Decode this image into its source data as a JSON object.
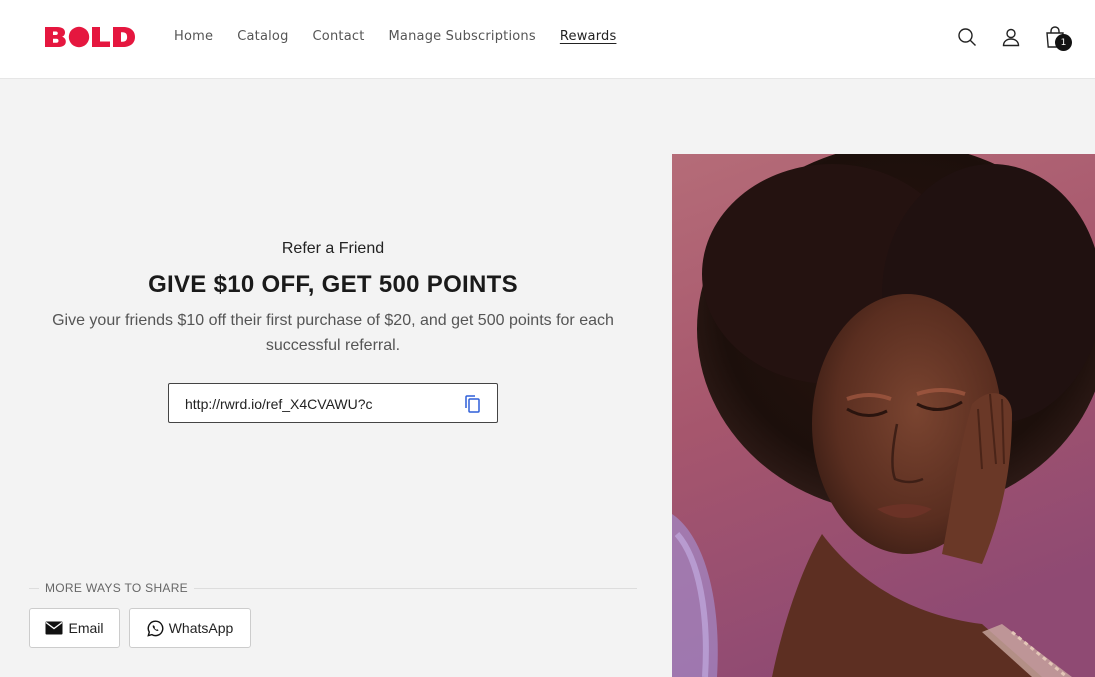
{
  "header": {
    "logo_text": "BOLD",
    "logo_color": "#e5173f",
    "nav": [
      {
        "label": "Home"
      },
      {
        "label": "Catalog"
      },
      {
        "label": "Contact"
      },
      {
        "label": "Manage Subscriptions"
      },
      {
        "label": "Rewards",
        "active": true
      }
    ],
    "icons": [
      "search-icon",
      "account-icon",
      "cart-icon"
    ],
    "cart_count": "1"
  },
  "referral": {
    "subtitle": "Refer a Friend",
    "headline": "GIVE $10 OFF, GET 500 POINTS",
    "description": "Give your friends $10 off their first purchase of $20, and get 500 points for each successful referral.",
    "link": "http://rwrd.io/ref_X4CVAWU?c",
    "share_heading": "MORE WAYS TO SHARE",
    "share_buttons": [
      {
        "label": "Email",
        "icon": "email-icon"
      },
      {
        "label": "WhatsApp",
        "icon": "whatsapp-icon"
      }
    ]
  },
  "hero_image": {
    "icon": "woman-portrait-photo"
  }
}
